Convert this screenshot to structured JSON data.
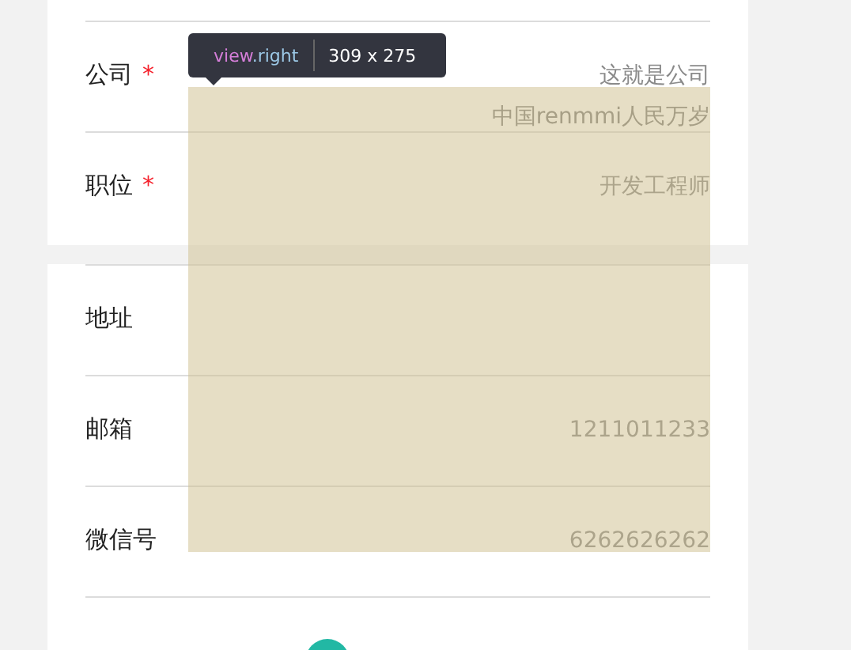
{
  "sections": [
    {
      "rows": [
        {
          "label": "公司",
          "required": true,
          "values": [
            "这就是公司",
            "中国renmmi人民万岁"
          ]
        },
        {
          "label": "职位",
          "required": true,
          "values": [
            "开发工程师"
          ]
        }
      ]
    },
    {
      "rows": [
        {
          "label": "地址",
          "required": false,
          "values": []
        },
        {
          "label": "邮箱",
          "required": false,
          "values": [
            "1211011233"
          ]
        },
        {
          "label": "微信号",
          "required": false,
          "values": [
            "6262626262"
          ]
        }
      ]
    }
  ],
  "inspector": {
    "tag": "view",
    "class_name": ".right",
    "size": "309 x 275"
  },
  "required_mark": "*"
}
